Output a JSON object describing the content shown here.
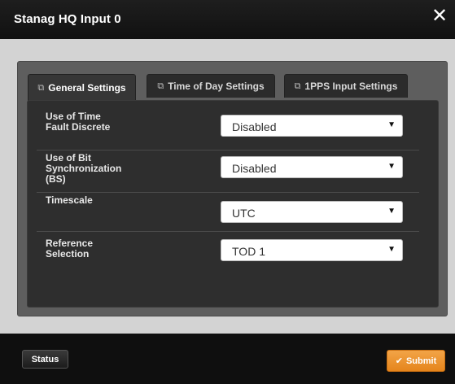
{
  "window": {
    "title": "Stanag HQ Input 0",
    "close_glyph": "✕"
  },
  "tabs": [
    {
      "label": "General Settings",
      "icon": "tab-icon",
      "icon_glyph": "⧉",
      "active": true
    },
    {
      "label": "Time of Day Settings",
      "icon": "tab-icon",
      "icon_glyph": "⧉",
      "active": false
    },
    {
      "label": "1PPS Input Settings",
      "icon": "tab-icon",
      "icon_glyph": "⧉",
      "active": false
    }
  ],
  "settings": [
    {
      "label": "Use of Time Fault Discrete",
      "value": "Disabled"
    },
    {
      "label": "Use of Bit Synchronization (BS)",
      "value": "Disabled"
    },
    {
      "label": "Timescale",
      "value": "UTC"
    },
    {
      "label": "Reference Selection",
      "value": "TOD 1"
    }
  ],
  "dropdown_caret": "▼",
  "footer": {
    "status_label": "Status",
    "submit_label": "Submit",
    "submit_glyph": "✔"
  },
  "colors": {
    "titlebar": "#111111",
    "panel": "#5e5e5e",
    "settings_box": "#2e2e2e",
    "submit": "#ec9430"
  }
}
